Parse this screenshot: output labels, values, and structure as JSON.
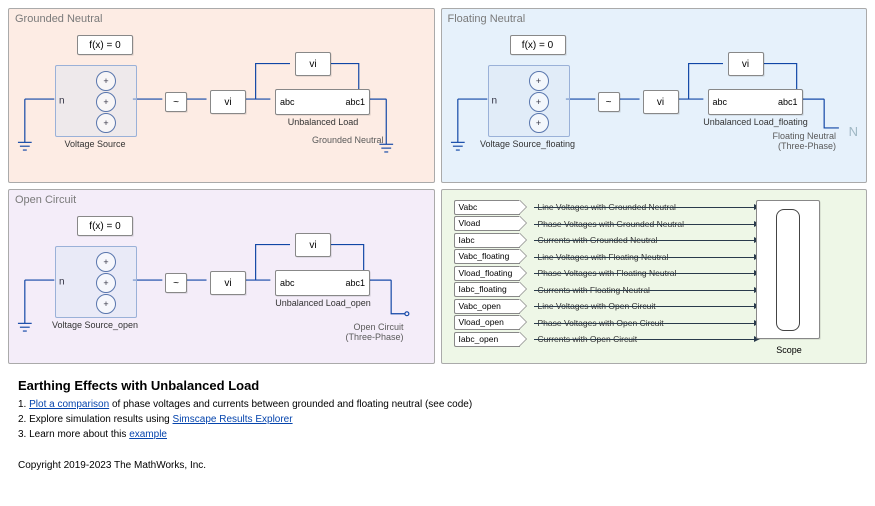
{
  "panels": {
    "grounded": {
      "title": "Grounded Neutral",
      "fx": "f(x) = 0",
      "vi": "vi",
      "tilde": "~",
      "abc_left": "abc",
      "abc_right": "abc1",
      "load_label": "Unbalanced Load",
      "src_label": "Voltage Source",
      "corner_label": "Grounded Neutral"
    },
    "floating": {
      "title": "Floating Neutral",
      "fx": "f(x) = 0",
      "vi": "vi",
      "tilde": "~",
      "abc_left": "abc",
      "abc_right": "abc1",
      "load_label": "Unbalanced Load_floating",
      "src_label": "Voltage Source_floating",
      "corner_l1": "Floating Neutral",
      "corner_l2": "(Three-Phase)",
      "n_glyph": "N"
    },
    "open": {
      "title": "Open Circuit",
      "fx": "f(x) = 0",
      "vi": "vi",
      "tilde": "~",
      "abc_left": "abc",
      "abc_right": "abc1",
      "load_label": "Unbalanced Load_open",
      "src_label": "Voltage Source_open",
      "corner_l1": "Open Circuit",
      "corner_l2": "(Three-Phase)"
    }
  },
  "scope": {
    "label": "Scope",
    "signals": [
      {
        "tag": "Vabc",
        "label": "Line Voltages with Grounded Neutral"
      },
      {
        "tag": "Vload",
        "label": "Phase Voltages with Grounded Neutral"
      },
      {
        "tag": "Iabc",
        "label": "Currents with Grounded Neutral"
      },
      {
        "tag": "Vabc_floating",
        "label": "Line Voltages with Floating Neutral"
      },
      {
        "tag": "Vload_floating",
        "label": "Phase Voltages with Floating Neutral"
      },
      {
        "tag": "Iabc_floating",
        "label": "Currents with Floating Neutral"
      },
      {
        "tag": "Vabc_open",
        "label": "Line Voltages with Open Circuit"
      },
      {
        "tag": "Vload_open",
        "label": "Phase Voltages with Open Circuit"
      },
      {
        "tag": "Iabc_open",
        "label": "Currents with Open Circuit"
      }
    ]
  },
  "footer": {
    "heading": "Earthing Effects with Unbalanced Load",
    "steps": [
      {
        "prefix": "1. ",
        "link": "Plot a comparison",
        "rest": " of phase voltages and currents between grounded and floating neutral (see code)"
      },
      {
        "prefix": "2. Explore simulation results using ",
        "link": "Simscape Results Explorer",
        "rest": ""
      },
      {
        "prefix": "3. Learn more about this ",
        "link": "example",
        "rest": ""
      }
    ],
    "copyright": "Copyright 2019-2023 The MathWorks, Inc."
  },
  "vsrc_glyphs": {
    "plus": "+",
    "minus": "−",
    "n": "n"
  }
}
